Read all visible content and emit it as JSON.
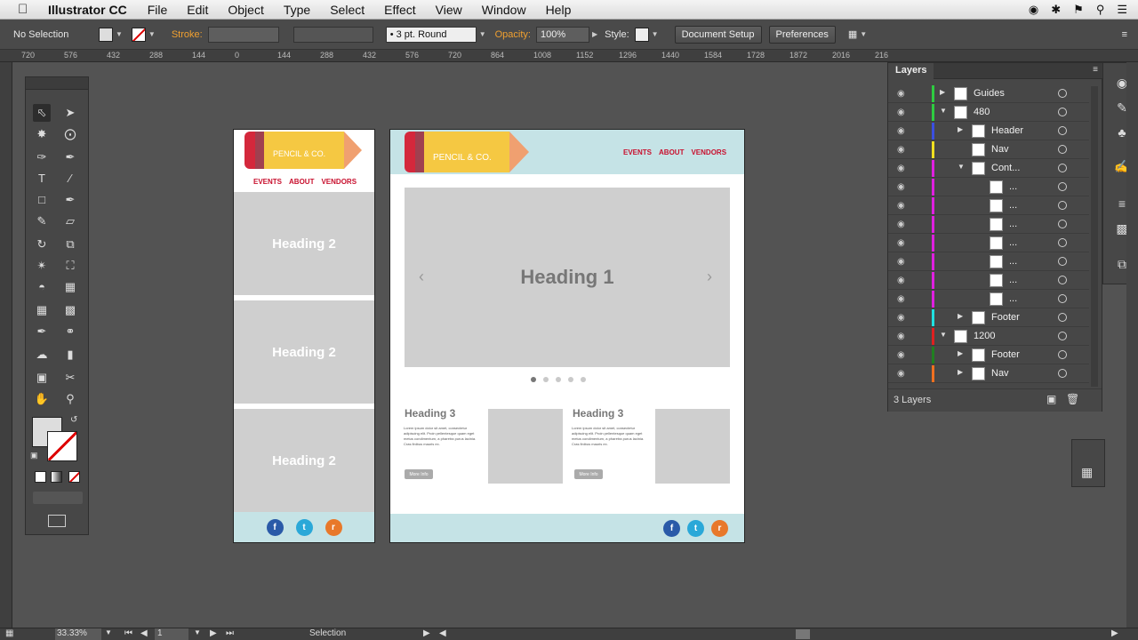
{
  "menubar": {
    "app_name": "Illustrator CC",
    "items": [
      "File",
      "Edit",
      "Object",
      "Type",
      "Select",
      "Effect",
      "View",
      "Window",
      "Help"
    ]
  },
  "control_bar": {
    "selection_label": "No Selection",
    "stroke_label": "Stroke:",
    "brush_value": "3 pt. Round",
    "opacity_label": "Opacity:",
    "opacity_value": "100%",
    "style_label": "Style:",
    "document_setup": "Document Setup",
    "preferences": "Preferences"
  },
  "ruler": {
    "ticks": [
      "720",
      "576",
      "432",
      "288",
      "144",
      "0",
      "144",
      "288",
      "432",
      "576",
      "720",
      "864",
      "1008",
      "1152",
      "1296",
      "1440",
      "1584",
      "1728",
      "1872",
      "2016",
      "216"
    ]
  },
  "layers_panel": {
    "title": "Layers",
    "footer": "3 Layers",
    "rows": [
      {
        "label": "Guides",
        "color": "#2ecc40",
        "indent": 0,
        "expand": "collapsed"
      },
      {
        "label": "480",
        "color": "#2ecc40",
        "indent": 0,
        "expand": "expanded"
      },
      {
        "label": "Header",
        "color": "#3b4fe0",
        "indent": 1,
        "expand": "collapsed"
      },
      {
        "label": "Nav",
        "color": "#f0e020",
        "indent": 1,
        "expand": "none"
      },
      {
        "label": "Cont...",
        "color": "#e020e0",
        "indent": 1,
        "expand": "expanded"
      },
      {
        "label": "...",
        "color": "#e020e0",
        "indent": 2,
        "expand": "none"
      },
      {
        "label": "...",
        "color": "#e020e0",
        "indent": 2,
        "expand": "none"
      },
      {
        "label": "...",
        "color": "#e020e0",
        "indent": 2,
        "expand": "none"
      },
      {
        "label": "...",
        "color": "#e020e0",
        "indent": 2,
        "expand": "none"
      },
      {
        "label": "...",
        "color": "#e020e0",
        "indent": 2,
        "expand": "none"
      },
      {
        "label": "...",
        "color": "#e020e0",
        "indent": 2,
        "expand": "none"
      },
      {
        "label": "...",
        "color": "#e020e0",
        "indent": 2,
        "expand": "none"
      },
      {
        "label": "Footer",
        "color": "#20e0e0",
        "indent": 1,
        "expand": "collapsed"
      },
      {
        "label": "1200",
        "color": "#e02020",
        "indent": 0,
        "expand": "expanded"
      },
      {
        "label": "Footer",
        "color": "#208020",
        "indent": 1,
        "expand": "collapsed"
      },
      {
        "label": "Nav",
        "color": "#f07020",
        "indent": 1,
        "expand": "collapsed"
      }
    ]
  },
  "status_bar": {
    "zoom": "33.33%",
    "page": "1",
    "tool": "Selection"
  },
  "mobile": {
    "brand": "PENCIL & CO.",
    "nav": [
      "EVENTS",
      "ABOUT",
      "VENDORS"
    ],
    "headings": [
      "Heading 2",
      "Heading 2",
      "Heading 2"
    ],
    "social": [
      "f",
      "t",
      "r"
    ]
  },
  "desktop": {
    "brand": "PENCIL & CO.",
    "nav": [
      "EVENTS",
      "ABOUT",
      "VENDORS"
    ],
    "hero": "Heading 1",
    "cards": [
      {
        "heading": "Heading 3",
        "text": "Lorem ipsum dolor sit amet, consectetur adipiscing elit. Proin pellentesque quam eget metus condimentum, a pharetra purus lacinia. Cras finibus mauris ex.",
        "button": "More Info"
      },
      {
        "heading": "Heading 3",
        "text": "Lorem ipsum dolor sit amet, consectetur adipiscing elit. Proin pellentesque quam eget metus condimentum, a pharetra purus lacinia. Cras finibus mauris ex.",
        "button": "More Info"
      }
    ],
    "social": [
      "f",
      "t",
      "r"
    ]
  },
  "colors": {
    "accent_red": "#c8102e",
    "pencil_yellow": "#f5c842",
    "header_teal": "#c5e3e6"
  }
}
